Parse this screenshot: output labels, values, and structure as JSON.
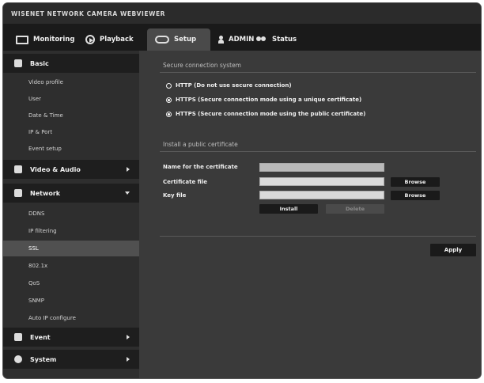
{
  "window": {
    "title": "WISENET NETWORK CAMERA WEBVIEWER"
  },
  "topnav": {
    "monitoring_label": "Monitoring",
    "playback_label": "Playback",
    "setup_label": "Setup",
    "admin_label": "ADMIN",
    "status_label": "Status",
    "active_tab": "Setup"
  },
  "sidebar": {
    "groups": [
      {
        "label": "Basic",
        "icon": "camera-icon",
        "expanded": true
      },
      {
        "label": "Video & Audio",
        "icon": "video-icon",
        "expanded": false
      },
      {
        "label": "Network",
        "icon": "network-icon",
        "expanded": true
      },
      {
        "label": "Event",
        "icon": "bell-icon",
        "expanded": false
      },
      {
        "label": "System",
        "icon": "gear-icon",
        "expanded": false
      }
    ],
    "basic_items": [
      "Video profile",
      "User",
      "Date & Time",
      "IP & Port",
      "Event setup"
    ],
    "network_items": [
      "DDNS",
      "IP filtering",
      "SSL",
      "802.1x",
      "QoS",
      "SNMP",
      "Auto IP configure"
    ],
    "selected_item": "SSL"
  },
  "main": {
    "secure_title": "Secure connection system",
    "options": [
      {
        "label": "HTTP (Do not use secure connection)",
        "selected": false
      },
      {
        "label": "HTTPS (Secure connection mode using a unique certificate)",
        "selected": false
      },
      {
        "label": "HTTPS (Secure connection mode using the public certificate)",
        "selected": true
      }
    ],
    "install_title": "Install a public certificate",
    "fields": {
      "name_label": "Name for the certificate",
      "cert_label": "Certificate file",
      "key_label": "Key file",
      "name_value": "",
      "cert_value": "",
      "key_value": ""
    },
    "browse_label": "Browse",
    "install_label": "Install",
    "delete_label": "Delete",
    "apply_label": "Apply"
  },
  "colors": {
    "background": "#3a3a3a",
    "sidebar": "#2e2e2e",
    "nav": "#1a1a1a",
    "selected": "#505050"
  }
}
